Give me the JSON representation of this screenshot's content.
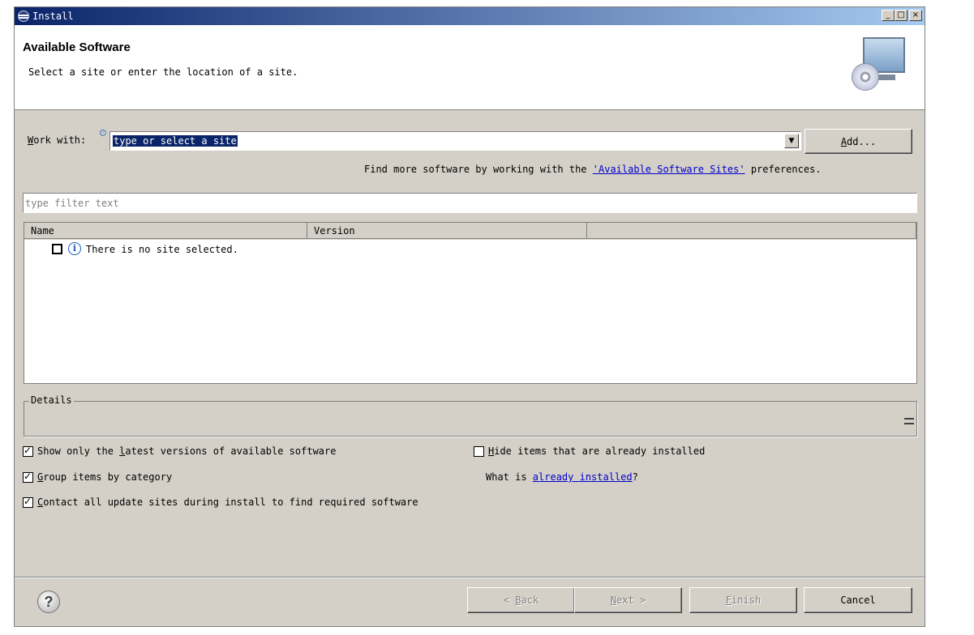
{
  "window": {
    "title": "Install"
  },
  "titlebar_buttons": {
    "minimize": "_",
    "maximize": "□",
    "close": "×"
  },
  "header": {
    "title": "Available Software",
    "subtitle": "Select a site or enter the location of a site."
  },
  "work_with": {
    "label_prefix": "W",
    "label_rest": "ork with:",
    "value": "type or select a site",
    "add_prefix": "A",
    "add_rest": "dd...",
    "find_more_text": "Find more software by working with the ",
    "find_more_link": "'Available Software Sites'",
    "find_more_suffix": " preferences."
  },
  "filter": {
    "placeholder": "type filter text"
  },
  "table": {
    "columns": [
      "Name",
      "Version",
      ""
    ],
    "rows": [
      {
        "name": "There is no site selected."
      }
    ]
  },
  "details": {
    "legend": "Details"
  },
  "options": {
    "latest_pre": "Show only the ",
    "latest_key": "l",
    "latest_post": "atest versions of available software",
    "latest_checked": true,
    "hide_key": "H",
    "hide_post": "ide items that are already installed",
    "hide_checked": false,
    "group_key": "G",
    "group_post": "roup items by category",
    "group_checked": true,
    "what_is": "What is ",
    "already_installed": "already installed",
    "what_is_suffix": "?",
    "contact_key": "C",
    "contact_post": "ontact all update sites during install to find required software",
    "contact_checked": true
  },
  "footer": {
    "help": "?",
    "back_pre": "< ",
    "back_key": "B",
    "back_post": "ack",
    "next_key": "N",
    "next_post": "ext >",
    "finish_key": "F",
    "finish_post": "inish",
    "cancel": "Cancel"
  }
}
